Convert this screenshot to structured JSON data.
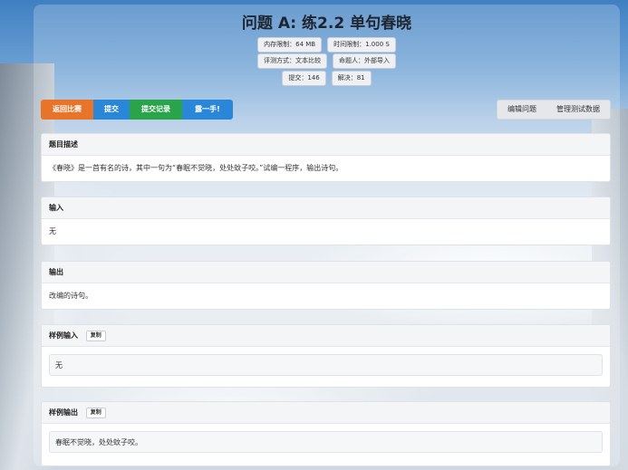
{
  "problem": {
    "title": "问题 A: 练2.2 单句春晓",
    "badges_row1": [
      "内存限制：64 MB",
      "时间限制：1.000 S"
    ],
    "badges_row2": [
      "评测方式：文本比较",
      "命题人：外部导入"
    ],
    "badges_row3": [
      "提交：146",
      "解决：81"
    ]
  },
  "actions": {
    "back": "返回比赛",
    "submit": "提交",
    "records": "提交记录",
    "show": "露一手!",
    "edit": "编辑问题",
    "manage": "管理测试数据"
  },
  "sections": {
    "description": {
      "title": "题目描述",
      "body": "《春晓》是一首有名的诗，其中一句为“春眠不觉晓，处处蚊子咬。”试编一程序，输出诗句。"
    },
    "input": {
      "title": "输入",
      "body": "无"
    },
    "output": {
      "title": "输出",
      "body": "改编的诗句。"
    },
    "sample_input": {
      "title": "样例输入",
      "copy": "复制",
      "body": "无"
    },
    "sample_output": {
      "title": "样例输出",
      "copy": "复制",
      "body": "春眠不觉晓，处处蚊子咬。"
    }
  },
  "colors": {
    "orange": "#e8742a",
    "blue": "#2a86d6",
    "green": "#2aa44a"
  }
}
